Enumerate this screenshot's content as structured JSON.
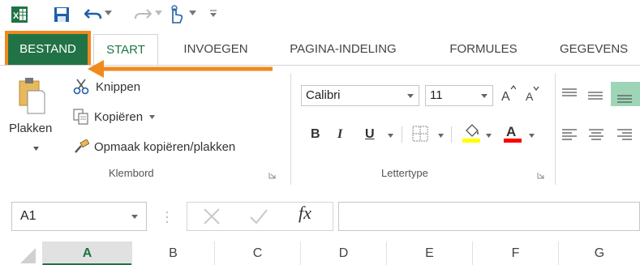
{
  "app": {
    "name": "Excel"
  },
  "quick_access": {
    "icons": [
      "excel-logo",
      "save-icon",
      "undo-icon",
      "redo-icon",
      "touch-mode-icon",
      "customize-icon"
    ]
  },
  "tabs": [
    {
      "label": "BESTAND",
      "active": false,
      "highlighted": true
    },
    {
      "label": "START",
      "active": true
    },
    {
      "label": "INVOEGEN"
    },
    {
      "label": "PAGINA-INDELING"
    },
    {
      "label": "FORMULES"
    },
    {
      "label": "GEGEVENS"
    }
  ],
  "clipboard": {
    "paste_label": "Plakken",
    "cut_label": "Knippen",
    "copy_label": "Kopiëren",
    "format_painter_label": "Opmaak kopiëren/plakken",
    "group_label": "Klembord"
  },
  "font": {
    "font_name": "Calibri",
    "font_size": "11",
    "bold": "B",
    "italic": "I",
    "underline": "U",
    "group_label": "Lettertype",
    "fill_color": "#ffff00",
    "font_color": "#ff0000"
  },
  "formula_bar": {
    "name_box": "A1",
    "fx": "fx",
    "formula": ""
  },
  "columns": [
    "A",
    "B",
    "C",
    "D",
    "E",
    "F",
    "G"
  ],
  "colors": {
    "excel_green": "#217346",
    "highlight_orange": "#f0891e",
    "active_align": "#9fd5b7"
  }
}
